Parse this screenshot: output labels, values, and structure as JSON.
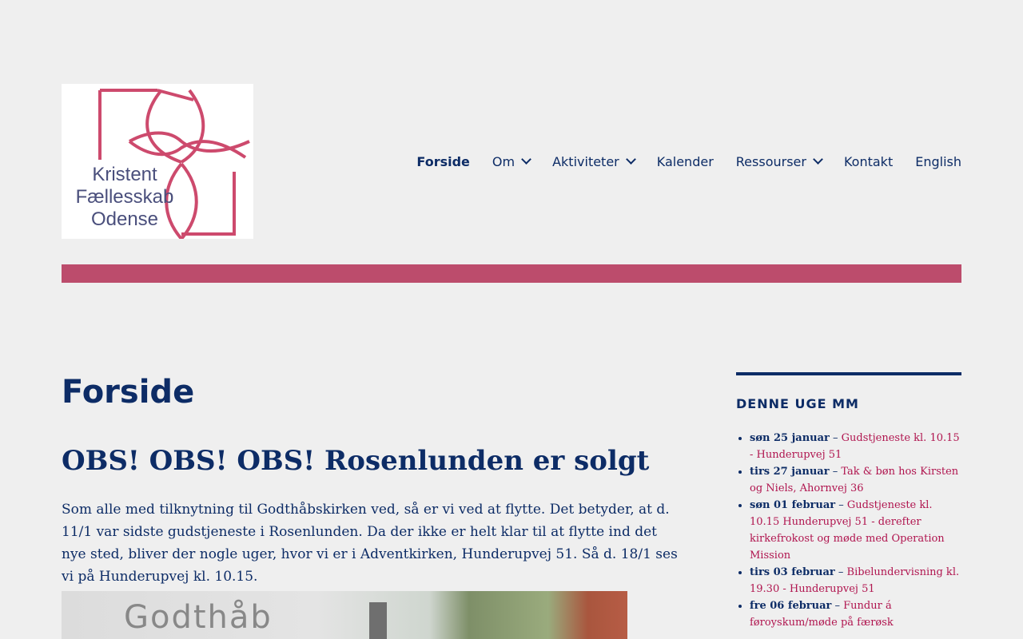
{
  "site": {
    "logo_lines": [
      "Kristent",
      "Fællesskab",
      "Odense"
    ]
  },
  "nav": {
    "items": [
      {
        "label": "Forside"
      },
      {
        "label": "Om"
      },
      {
        "label": "Aktiviteter"
      },
      {
        "label": "Kalender"
      },
      {
        "label": "Ressourser"
      },
      {
        "label": "Kontakt"
      },
      {
        "label": "English"
      }
    ]
  },
  "main": {
    "page_title": "Forside",
    "post_title": "OBS! OBS! OBS! Rosenlunden er solgt",
    "post_body": "Som alle med tilknytning til Godthåbskirken ved, så er vi ved at flytte. Det betyder, at d. 11/1 var sidste gudstjeneste i Rosenlunden. Da der ikke er helt klar til at flytte ind det nye sted, bliver der nogle uger, hvor vi er i Adventkirken, Hunderupvej 51. Så d. 18/1 ses vi på Hunderupvej kl. 10.15.",
    "image_text": "Godthåb"
  },
  "sidebar": {
    "widget_title": "DENNE UGE MM",
    "separator": " – ",
    "events": [
      {
        "date": "søn 25 januar",
        "title": "Gudstjeneste kl. 10.15 - Hunderupvej 51"
      },
      {
        "date": "tirs 27 januar",
        "title": "Tak & bøn hos Kirsten og Niels, Ahornvej 36"
      },
      {
        "date": "søn 01 februar",
        "title": "Gudstjeneste kl. 10.15 Hunderupvej 51 - derefter kirkefrokost og møde med Operation Mission"
      },
      {
        "date": "tirs 03 februar",
        "title": "Bibelundervisning kl. 19.30 - Hunderupvej 51"
      },
      {
        "date": "fre 06 februar",
        "title": "Fundur á føroyskum/møde på færøsk"
      }
    ]
  },
  "colors": {
    "accent": "#bc4c6c",
    "link": "#b0154f",
    "text": "#0d2c66",
    "background": "#efefef"
  }
}
